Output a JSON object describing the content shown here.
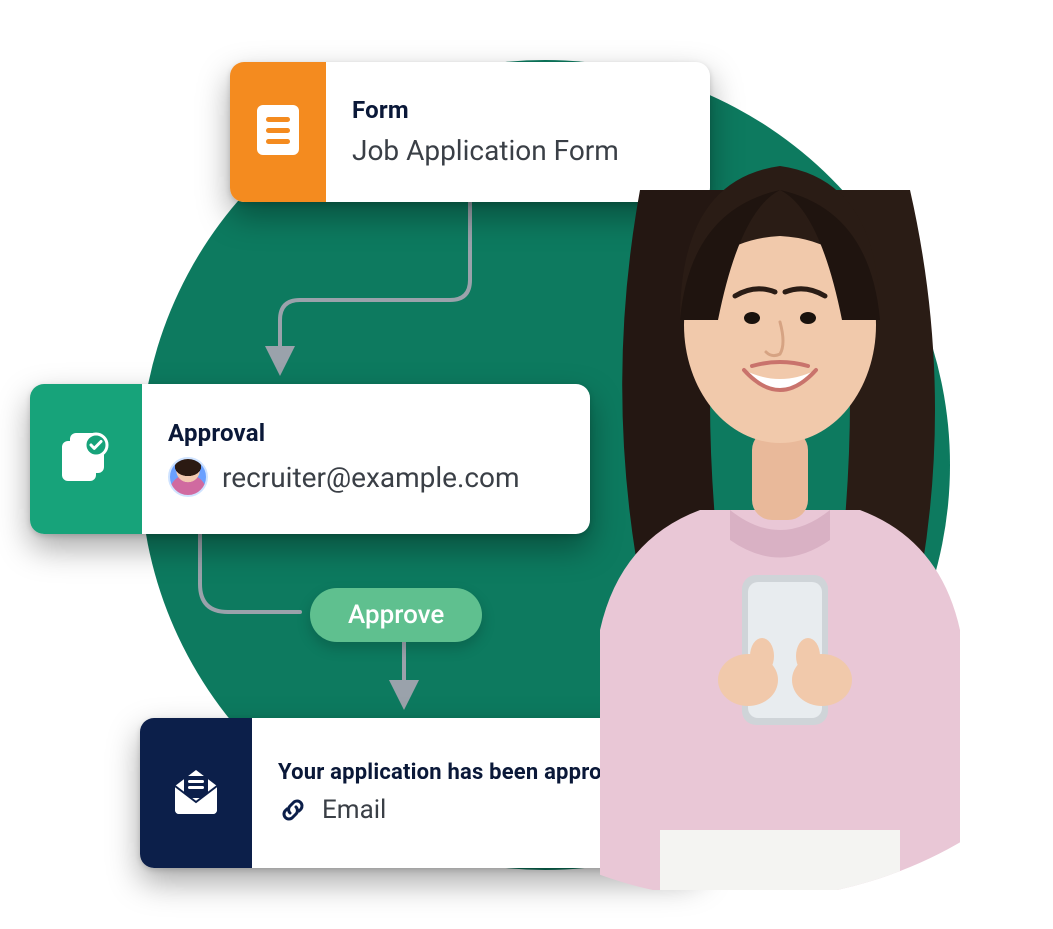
{
  "colors": {
    "circle": "#0d7a5f",
    "form_accent": "#f48b1f",
    "approval_accent": "#17a37a",
    "email_accent": "#0c1f4a",
    "approve_pill": "#5fc08f",
    "text_dark": "#0a1838",
    "text_body": "#3a3f46"
  },
  "cards": {
    "form": {
      "title": "Form",
      "subtitle": "Job Application Form",
      "icon": "document-icon"
    },
    "approval": {
      "title": "Approval",
      "email": "recruiter@example.com",
      "icon": "approval-check-icon"
    },
    "email": {
      "title": "Your application has been approved",
      "channel": "Email",
      "icon": "envelope-icon",
      "link_icon": "link-icon"
    }
  },
  "approve_button": {
    "label": "Approve"
  },
  "person": {
    "description": "Smiling woman with long dark wavy hair, pink sweatshirt, holding a smartphone"
  }
}
